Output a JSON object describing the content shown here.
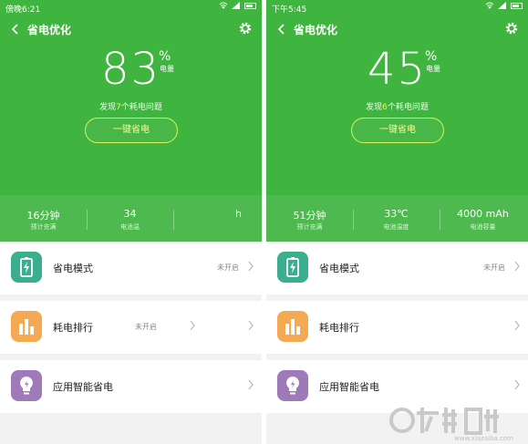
{
  "phones": [
    {
      "status_time": "傍晚6:21",
      "title": "省电优化",
      "score": "83",
      "percent_sign": "%",
      "score_label": "电量",
      "found_prefix": "发现",
      "found_count": "7",
      "found_suffix": "个耗电问题",
      "button": "一键省电",
      "stats": [
        {
          "value": "16分钟",
          "label": "预计充满"
        },
        {
          "value": "34",
          "label": "电池温"
        },
        {
          "value": "h",
          "label": ""
        }
      ],
      "items": [
        {
          "name": "省电模式",
          "state": "未开启",
          "icon": "battery-icon"
        },
        {
          "name": "耗电排行",
          "state": "未开启",
          "icon": "bar-chart-icon"
        },
        {
          "name": "应用智能省电",
          "state": "",
          "icon": "bulb-icon"
        }
      ]
    },
    {
      "status_time": "下午5:45",
      "title": "省电优化",
      "score": "45",
      "percent_sign": "%",
      "score_label": "电量",
      "found_prefix": "发现",
      "found_count": "6",
      "found_suffix": "个耗电问题",
      "button": "一键省电",
      "stats": [
        {
          "value": "51分钟",
          "label": "预计充满"
        },
        {
          "value": "33℃",
          "label": "电池温度"
        },
        {
          "value": "4000 mAh",
          "label": "电池容量"
        }
      ],
      "items": [
        {
          "name": "省电模式",
          "state": "未开启",
          "icon": "battery-icon"
        },
        {
          "name": "耗电排行",
          "state": "",
          "icon": "bar-chart-icon"
        },
        {
          "name": "应用智能省电",
          "state": "",
          "icon": "bulb-icon"
        }
      ]
    }
  ],
  "watermark_url": "www.xiazaiba.com",
  "colors": {
    "header_green": "#3fb43f",
    "button_border": "#d8f55a",
    "highlight": "#ffee58"
  }
}
